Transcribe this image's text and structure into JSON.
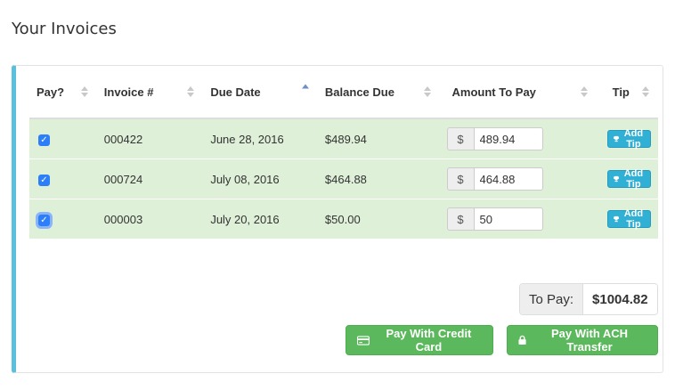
{
  "page": {
    "title": "Your Invoices"
  },
  "table": {
    "headers": {
      "pay": "Pay?",
      "invoice": "Invoice #",
      "due_date": "Due Date",
      "balance": "Balance Due",
      "amount": "Amount To Pay",
      "tip": "Tip"
    },
    "sorted_column": "due_date",
    "sort_direction": "ascending",
    "rows": [
      {
        "checked": true,
        "invoice": "000422",
        "due_date": "June 28, 2016",
        "balance": "$489.94",
        "currency": "$",
        "amount": "489.94",
        "tip_label": "Add Tip"
      },
      {
        "checked": true,
        "invoice": "000724",
        "due_date": "July 08, 2016",
        "balance": "$464.88",
        "currency": "$",
        "amount": "464.88",
        "tip_label": "Add Tip"
      },
      {
        "checked": true,
        "invoice": "000003",
        "due_date": "July 20, 2016",
        "balance": "$50.00",
        "currency": "$",
        "amount": "50",
        "tip_label": "Add Tip"
      }
    ]
  },
  "summary": {
    "label": "To Pay:",
    "total": "$1004.82"
  },
  "buttons": {
    "credit_card": "Pay With Credit Card",
    "ach": "Pay With ACH Transfer"
  },
  "colors": {
    "accent_border": "#5bc0de",
    "row_selected": "#dff0d8",
    "tip_button": "#31b0d5",
    "pay_button": "#5cb85c",
    "checkbox": "#2d7ff9"
  },
  "icons": {
    "tip": "trophy-icon",
    "credit_card": "credit-card-icon",
    "ach": "lock-icon",
    "sort": "sort-icon",
    "check": "checkmark-icon"
  }
}
